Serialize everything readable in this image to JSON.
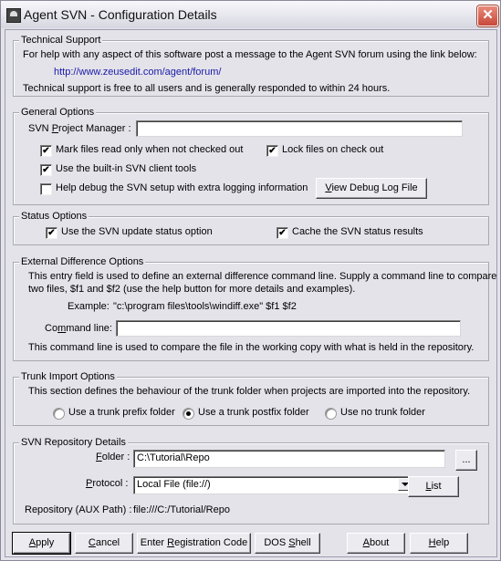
{
  "window": {
    "title": "Agent SVN - Configuration Details",
    "close_glyph": "✕"
  },
  "tech_support": {
    "legend": "Technical Support",
    "intro": "For help with any aspect of this software post a message to the Agent SVN forum using the link below:",
    "link": "http://www.zeusedit.com/agent/forum/",
    "note": "Technical support is free to all users and is generally responded to within 24 hours."
  },
  "general": {
    "legend": "General Options",
    "project_manager_label": "SVN Project Manager :",
    "project_manager_value": "",
    "checkboxes": [
      {
        "label": "Mark files read only when not checked out",
        "checked": true
      },
      {
        "label": "Lock files on check out",
        "checked": true
      },
      {
        "label": "Use the built-in SVN client tools",
        "checked": true
      },
      {
        "label": "Help debug the SVN setup with extra logging information",
        "checked": false
      }
    ],
    "view_log_button": "View Debug Log File"
  },
  "status": {
    "legend": "Status Options",
    "checkboxes": [
      {
        "label": "Use the SVN update status option",
        "checked": true
      },
      {
        "label": "Cache the SVN status results",
        "checked": true
      }
    ]
  },
  "external_diff": {
    "legend": "External Difference Options",
    "desc_line1": "This entry field is used to define an external difference command line. Supply a command line to compare",
    "desc_line2": "two files, $f1 and $f2 (use the help button for more details and examples).",
    "example_label": "Example:",
    "example_value": "\"c:\\program files\\tools\\windiff.exe\" $f1 $f2",
    "command_label": "Command line:",
    "command_value": "",
    "footer": "This command line is used to compare the file in the working copy with what is held in the repository."
  },
  "trunk": {
    "legend": "Trunk Import Options",
    "desc": "This section defines the behaviour of the trunk folder when projects are imported into the repository.",
    "options": [
      {
        "label": "Use a trunk prefix folder",
        "selected": false
      },
      {
        "label": "Use a trunk postfix folder",
        "selected": true
      },
      {
        "label": "Use no trunk folder",
        "selected": false
      }
    ]
  },
  "repo": {
    "legend": "SVN Repository Details",
    "folder_label": "Folder :",
    "folder_value": "C:\\Tutorial\\Repo",
    "browse_button": "...",
    "protocol_label": "Protocol :",
    "protocol_value": "Local File (file://)",
    "list_button": "List",
    "aux_label": "Repository (AUX Path) :",
    "aux_value": "file:///C:/Tutorial/Repo"
  },
  "buttons": {
    "apply": "Apply",
    "cancel": "Cancel",
    "register": "Enter Registration Code",
    "dos": "DOS Shell",
    "about": "About",
    "help": "Help"
  }
}
